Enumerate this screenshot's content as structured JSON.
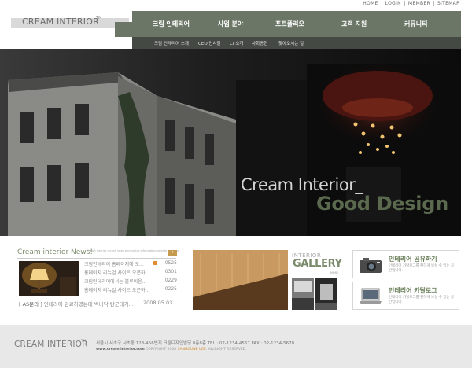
{
  "util_links": [
    "HOME",
    "LOGIN",
    "MEMBER",
    "SITEMAP"
  ],
  "logo": {
    "text": "CREAM INTERIOR",
    "tm": "TM"
  },
  "nav": [
    "크림 인테리어",
    "사업 분야",
    "포트폴리오",
    "고객 지원",
    "커뮤니티"
  ],
  "subnav": [
    "크림 인테리어 소개",
    "CEO 인사말",
    "CI 소개",
    "사회공헌",
    "찾아오시는 길"
  ],
  "hero": {
    "line1": "Cream Interior_",
    "line2": "Good Design"
  },
  "news": {
    "title": "Cream interior News!!",
    "subtitle": "Cream interior recent news and notice information update list here",
    "more": "+",
    "items": [
      {
        "title": "크림인테리어 홈페이지에 오...",
        "date": "0525",
        "new": true
      },
      {
        "title": "홈페이지 리뉴얼 사이트 오픈하였...",
        "date": "0301",
        "new": false
      },
      {
        "title": "크림인테리어에서는 블루이운...",
        "date": "0229",
        "new": false
      },
      {
        "title": "홈페이지 리뉴얼 사이트 오픈하였...",
        "date": "0225",
        "new": false
      }
    ],
    "notice_tag": "[ AS문의 ]",
    "notice_text": "인테리어 완료하였는데 벽바닥 탄군데가...",
    "notice_date": "2008.05.03"
  },
  "gallery": {
    "label_small": "INTERIOR",
    "label_big": "GALLERY",
    "more": "MORE"
  },
  "boxes": [
    {
      "title": "인테리어 공유하기",
      "desc": "인테리어 카탈로그를 편하게 보실 수 있는 공간입니다.",
      "icon": "camera-icon"
    },
    {
      "title": "인테리어 카달로그",
      "desc": "인테리어 카탈로그를 편하게 보실 수 있는 공간입니다.",
      "icon": "laptop-icon"
    }
  ],
  "footer": {
    "logo": "CREAM INTERIOR",
    "tm": "TM",
    "address": "서울시 서초구 서초동 123-456번지 크림디자인빌딩 8층8층 TEL : 02-1234-4567   FAX : 02-1234-5678",
    "copy_site": "www.cream interior.com",
    "copy_mid": "COPYRIGHT 2008",
    "copy_brand": "SANGGUNE UEE",
    "copy_end": ". ALLRIGHT RESERVED."
  },
  "colors": {
    "nav": "#6b7666",
    "subnav": "#454944",
    "accent_green": "#5b6a4e",
    "accent_orange": "#e08a32"
  }
}
